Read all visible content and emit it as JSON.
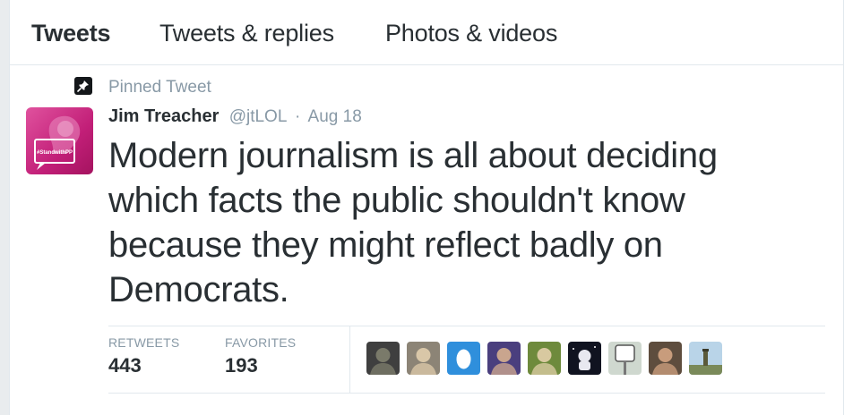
{
  "tabs": [
    {
      "label": "Tweets",
      "active": true
    },
    {
      "label": "Tweets & replies",
      "active": false
    },
    {
      "label": "Photos & videos",
      "active": false
    }
  ],
  "pinned": {
    "label": "Pinned Tweet",
    "icon": "pin-icon"
  },
  "tweet": {
    "fullname": "Jim Treacher",
    "screen_name": "@jtLOL",
    "separator": "·",
    "time": "Aug 18",
    "text": "Modern journalism is all about deciding which facts the public shouldn't know because they might reflect badly on Democrats.",
    "avatar_badge": "#StandwithPP"
  },
  "stats": {
    "retweets_label": "RETWEETS",
    "retweets_value": "443",
    "favorites_label": "FAVORITES",
    "favorites_value": "193"
  },
  "faces": [
    {
      "name": "dog",
      "bg": "#3f3f3f",
      "fg": "#7a7a6a"
    },
    {
      "name": "portrait-painting",
      "bg": "#8c8476",
      "fg": "#d9c7a8"
    },
    {
      "name": "egg",
      "bg": "#2f8fdc",
      "fg": "#ffffff"
    },
    {
      "name": "man-glasses",
      "bg": "#4a3f7e",
      "fg": "#c9a58e"
    },
    {
      "name": "presenter",
      "bg": "#6e8a3c",
      "fg": "#d8c9a0"
    },
    {
      "name": "astronaut",
      "bg": "#101320",
      "fg": "#e8e8f0"
    },
    {
      "name": "road-sign",
      "bg": "#cfd8cf",
      "fg": "#4a4a4a"
    },
    {
      "name": "woman",
      "bg": "#5e4d3e",
      "fg": "#c89c7c"
    },
    {
      "name": "lighthouse",
      "bg": "#b9d4e8",
      "fg": "#5a5a3a"
    }
  ],
  "colors": {
    "accent_text": "#292f33",
    "muted": "#8899a6",
    "avatar": "#c21f78"
  }
}
